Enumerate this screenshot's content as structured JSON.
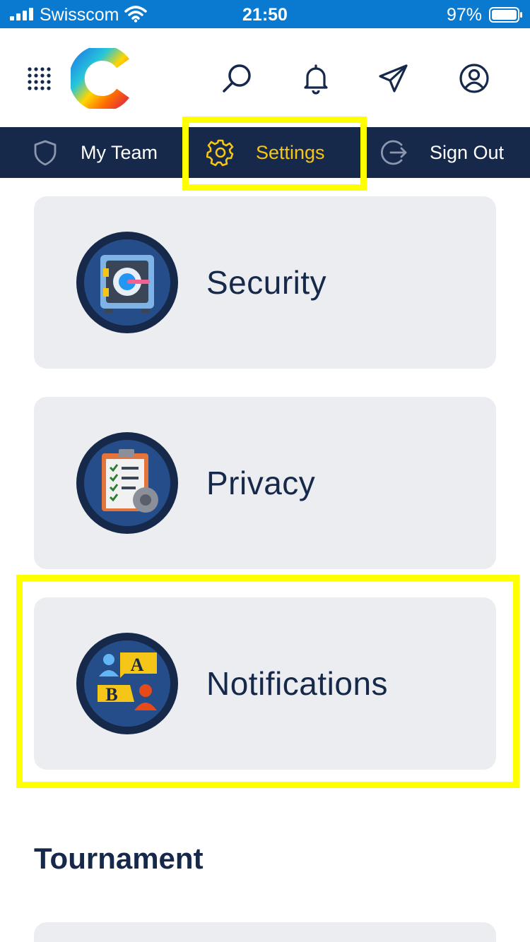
{
  "status_bar": {
    "carrier": "Swisscom",
    "time": "21:50",
    "battery_percent": "97%"
  },
  "header": {
    "icons": [
      "grid-menu-icon",
      "app-logo",
      "search-icon",
      "bell-icon",
      "paper-plane-icon",
      "user-profile-icon"
    ]
  },
  "tabs": [
    {
      "label": "My Team",
      "icon": "shield-icon",
      "active": false
    },
    {
      "label": "Settings",
      "icon": "gear-icon",
      "active": true
    },
    {
      "label": "Sign Out",
      "icon": "sign-out-icon",
      "active": false
    }
  ],
  "settings_items": [
    {
      "label": "Security",
      "icon": "safe-icon"
    },
    {
      "label": "Privacy",
      "icon": "clipboard-checklist-icon"
    },
    {
      "label": "Notifications",
      "icon": "chat-people-icon"
    }
  ],
  "section": {
    "title": "Tournament"
  },
  "colors": {
    "status_bar": "#0a7ad0",
    "nav_bar": "#16294a",
    "active_tab": "#f5c518",
    "card_bg": "#ecedf1",
    "highlight": "#ffff00",
    "text_dark": "#16294a"
  }
}
